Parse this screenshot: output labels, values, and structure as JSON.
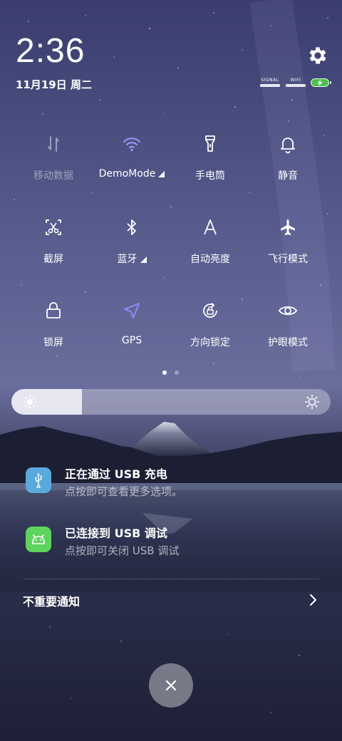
{
  "header": {
    "time": "2:36",
    "date": "11月19日 周二",
    "signal_label": "SIGNAL",
    "wifi_label": "WIFI"
  },
  "quick_settings": {
    "row1": [
      {
        "label": "移动数据",
        "icon": "mobile-data-icon",
        "active": false
      },
      {
        "label": "DemoMode",
        "icon": "wifi-icon",
        "active": true,
        "expandable": true
      },
      {
        "label": "手电筒",
        "icon": "flashlight-icon",
        "active": false
      },
      {
        "label": "静音",
        "icon": "bell-icon",
        "active": false
      }
    ],
    "row2": [
      {
        "label": "截屏",
        "icon": "screenshot-icon",
        "active": false
      },
      {
        "label": "蓝牙",
        "icon": "bluetooth-icon",
        "active": false,
        "expandable": true
      },
      {
        "label": "自动亮度",
        "icon": "auto-brightness-icon",
        "active": false
      },
      {
        "label": "飞行模式",
        "icon": "airplane-icon",
        "active": false
      }
    ],
    "row3": [
      {
        "label": "锁屏",
        "icon": "lock-icon",
        "active": false
      },
      {
        "label": "GPS",
        "icon": "gps-icon",
        "active": true
      },
      {
        "label": "方向锁定",
        "icon": "rotation-lock-icon",
        "active": false
      },
      {
        "label": "护眼模式",
        "icon": "eye-icon",
        "active": false
      }
    ],
    "page_count": 2,
    "current_page": 1
  },
  "brightness": {
    "level": 0.22
  },
  "notifications": [
    {
      "title": "正在通过 USB 充电",
      "subtitle": "点按即可查看更多选项。",
      "icon": "usb-icon",
      "icon_color": "#5aa9dd"
    },
    {
      "title": "已连接到 USB 调试",
      "subtitle": "点按即可关闭 USB 调试",
      "icon": "android-debug-icon",
      "icon_color": "#5fd35f"
    }
  ],
  "unimportant": {
    "label": "不重要通知"
  },
  "colors": {
    "active_wifi": "#9b9bff",
    "active_gps": "#8a8fff",
    "battery": "#4ec04e"
  }
}
